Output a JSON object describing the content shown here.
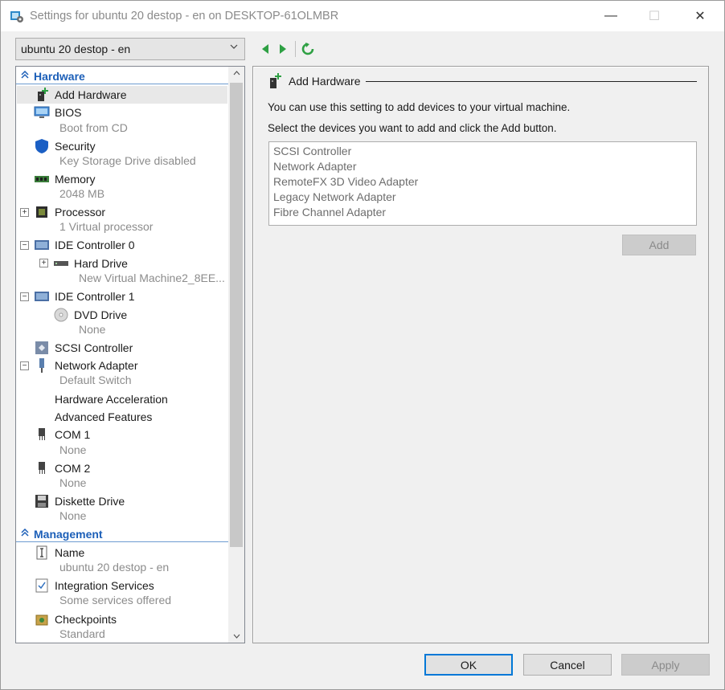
{
  "window": {
    "title": "Settings for ubuntu 20 destop - en on DESKTOP-61OLMBR",
    "min_glyph": "—",
    "max_glyph": "☐",
    "close_glyph": "✕"
  },
  "vm_selector": {
    "value": "ubuntu 20 destop - en"
  },
  "tree": {
    "hardware_header": "Hardware",
    "management_header": "Management",
    "items": {
      "add_hardware": {
        "label": "Add Hardware"
      },
      "bios": {
        "label": "BIOS",
        "sub": "Boot from CD"
      },
      "security": {
        "label": "Security",
        "sub": "Key Storage Drive disabled"
      },
      "memory": {
        "label": "Memory",
        "sub": "2048 MB"
      },
      "processor": {
        "label": "Processor",
        "sub": "1 Virtual processor"
      },
      "ide0": {
        "label": "IDE Controller 0"
      },
      "hard_drive": {
        "label": "Hard Drive",
        "sub": "New Virtual Machine2_8EE..."
      },
      "ide1": {
        "label": "IDE Controller 1"
      },
      "dvd": {
        "label": "DVD Drive",
        "sub": "None"
      },
      "scsi": {
        "label": "SCSI Controller"
      },
      "network": {
        "label": "Network Adapter",
        "sub": "Default Switch"
      },
      "hw_accel": {
        "label": "Hardware Acceleration"
      },
      "adv_features": {
        "label": "Advanced Features"
      },
      "com1": {
        "label": "COM 1",
        "sub": "None"
      },
      "com2": {
        "label": "COM 2",
        "sub": "None"
      },
      "diskette": {
        "label": "Diskette Drive",
        "sub": "None"
      },
      "name": {
        "label": "Name",
        "sub": "ubuntu 20 destop - en"
      },
      "integration": {
        "label": "Integration Services",
        "sub": "Some services offered"
      },
      "checkpoints": {
        "label": "Checkpoints",
        "sub": "Standard"
      }
    }
  },
  "right": {
    "header": "Add Hardware",
    "desc1": "You can use this setting to add devices to your virtual machine.",
    "desc2": "Select the devices you want to add and click the Add button.",
    "devices": [
      "SCSI Controller",
      "Network Adapter",
      "RemoteFX 3D Video Adapter",
      "Legacy Network Adapter",
      "Fibre Channel Adapter"
    ],
    "add_label": "Add"
  },
  "buttons": {
    "ok": "OK",
    "cancel": "Cancel",
    "apply": "Apply"
  },
  "colors": {
    "accent": "#0078d7",
    "section_header": "#1c5fb8",
    "nav_green": "#2ea043"
  }
}
